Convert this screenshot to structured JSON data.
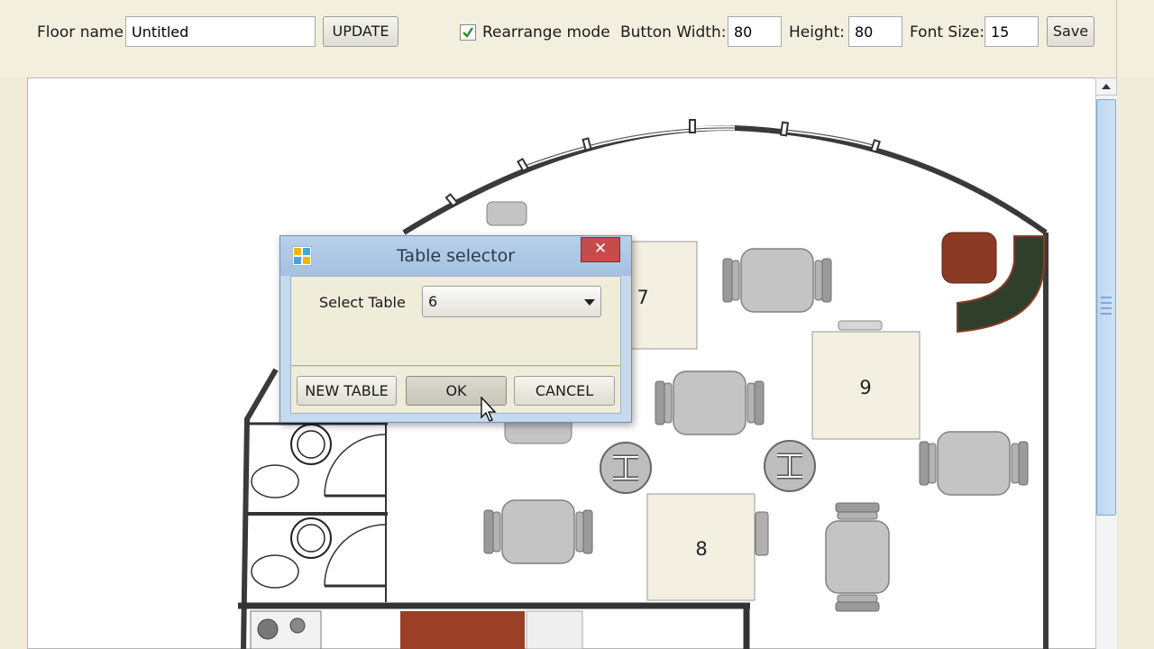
{
  "toolbar": {
    "floor_name_label": "Floor name",
    "floor_name_value": "Untitled",
    "update_label": "UPDATE",
    "rearrange_label": "Rearrange mode",
    "rearrange_checked": true,
    "button_width_label": "Button Width:",
    "button_width_value": "80",
    "height_label": "Height:",
    "height_value": "80",
    "font_size_label": "Font Size:",
    "font_size_value": "15",
    "save_label": "Save"
  },
  "floor": {
    "tables": [
      {
        "label": "7"
      },
      {
        "label": "9"
      },
      {
        "label": "8"
      }
    ]
  },
  "dialog": {
    "title": "Table selector",
    "close_glyph": "✕",
    "select_label": "Select Table",
    "select_value": "6",
    "new_table_label": "NEW TABLE",
    "ok_label": "OK",
    "cancel_label": "CANCEL"
  },
  "colors": {
    "dialog_frame": "#c7d9ec",
    "close_button": "#c84b4b",
    "scroll_thumb": "#bcd6f0",
    "wall": "#3a3a3a",
    "table_fill": "#f3f0e2",
    "chair_fill": "#c4c4c4",
    "lounge_green": "#2f3f2c",
    "brown_accent": "#8b3a26"
  }
}
